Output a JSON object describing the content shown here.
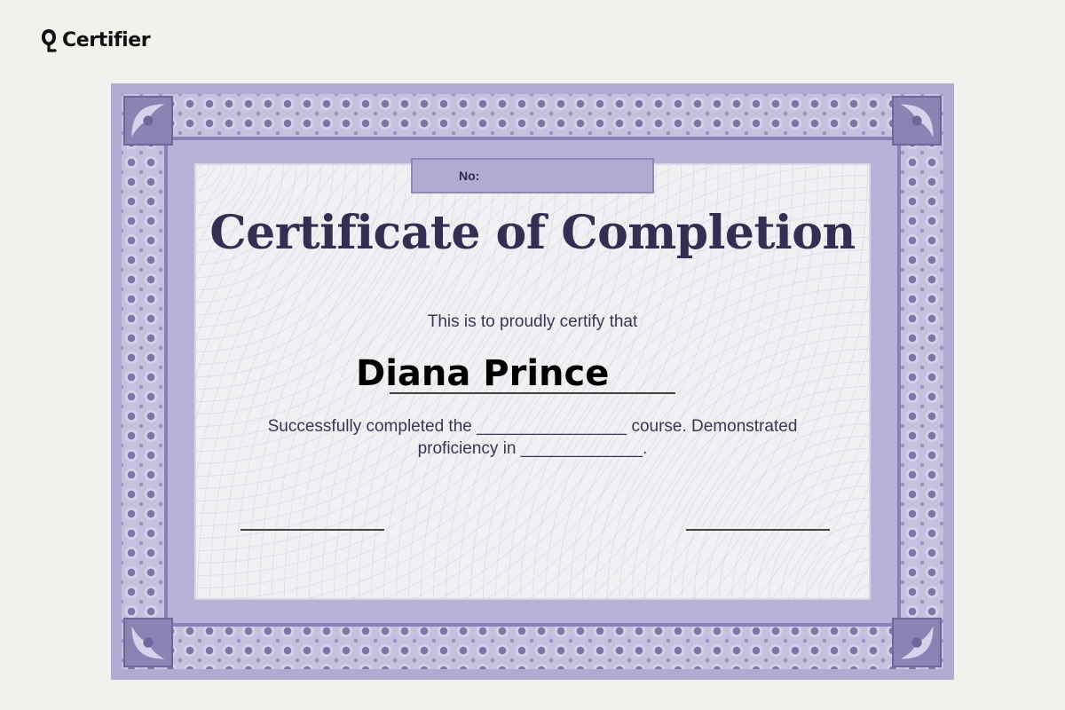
{
  "brand": {
    "name": "Certifier",
    "icon": "certifier-logo-icon"
  },
  "certificate": {
    "number_label": "No:",
    "title": "Certificate of Completion",
    "subtitle": "This is to proudly certify that",
    "recipient": "Diana Prince",
    "body_line1": "Successfully completed the ________________ course. Demonstrated",
    "body_line2": "proficiency in _____________.",
    "colors": {
      "frame": "#b1abd3",
      "frame_dark": "#7e75a8",
      "title": "#332e52",
      "body_text": "#3a3554",
      "paper": "#f1f0f3",
      "page_background": "#f2f1ee"
    }
  }
}
